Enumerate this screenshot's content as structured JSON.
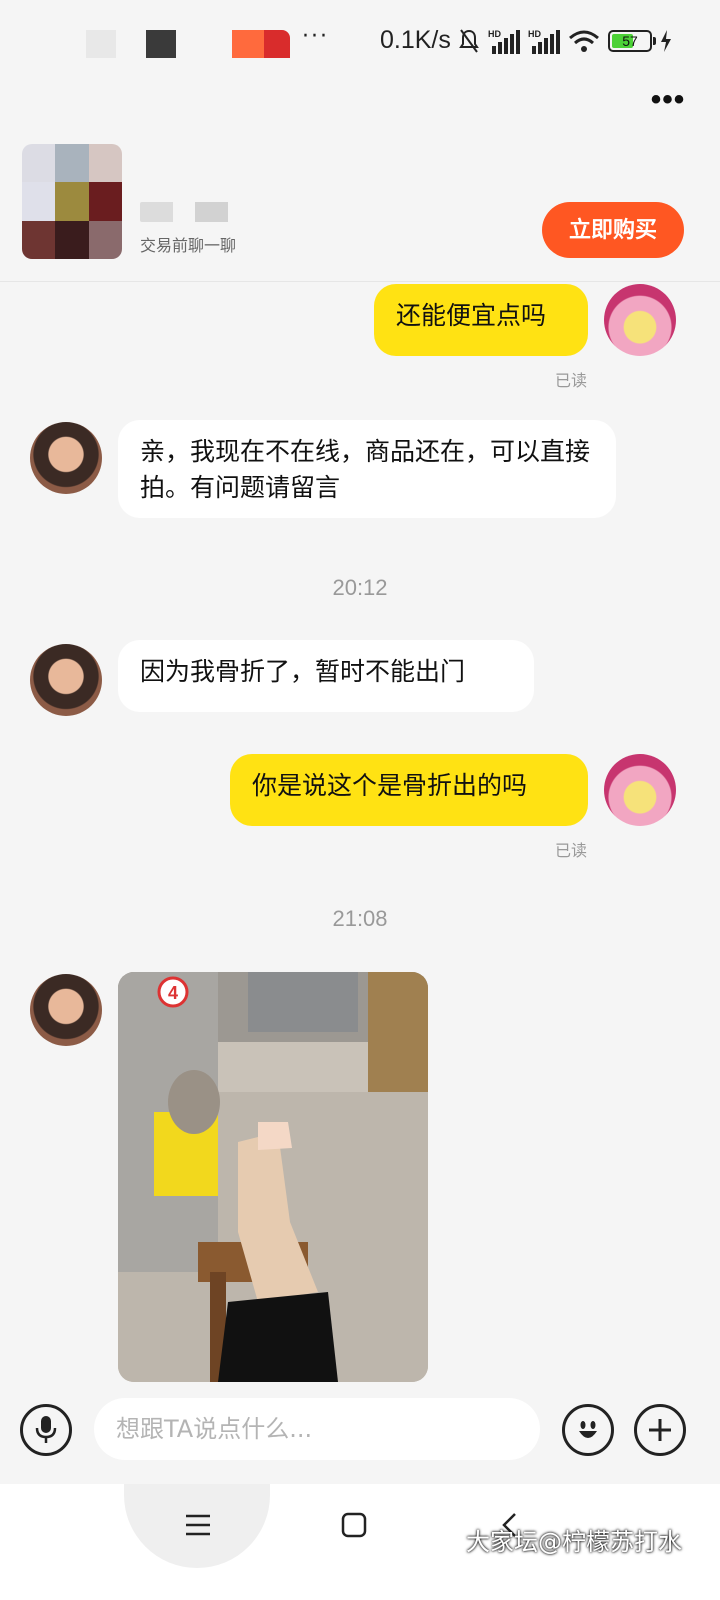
{
  "status_bar": {
    "network_speed": "0.1K/s",
    "battery_level": "57",
    "battery_fraction": 0.57,
    "icons": [
      "mute-bell-icon",
      "hd-signal-icon",
      "hd-signal-icon",
      "wifi-icon",
      "battery-icon",
      "charging-icon"
    ]
  },
  "header": {
    "more_icon": "more-dots-icon"
  },
  "product": {
    "subtitle": "交易前聊一聊",
    "buy_label": "立即购买",
    "buy_color": "#ff5722"
  },
  "messages": [
    {
      "side": "me",
      "text": "还能便宜点吗",
      "read_label": "已读"
    },
    {
      "side": "peer",
      "text": "亲，我现在不在线，商品还在，可以直接拍。有问题请留言"
    },
    {
      "type": "time",
      "text": "20:12"
    },
    {
      "side": "peer",
      "text": "因为我骨折了，暂时不能出门"
    },
    {
      "side": "me",
      "text": "你是说这个是骨折出的吗",
      "read_label": "已读"
    },
    {
      "type": "time",
      "text": "21:08"
    },
    {
      "side": "peer",
      "type": "image",
      "badge": "4"
    }
  ],
  "input_bar": {
    "placeholder": "想跟TA说点什么...",
    "voice_icon": "microphone-icon",
    "emoji_icon": "emoji-icon",
    "plus_icon": "plus-icon"
  },
  "nav": {
    "menu_icon": "menu-icon",
    "home_icon": "home-square-icon",
    "back_icon": "back-chevron-icon"
  },
  "watermark": "大家坛@柠檬苏打水",
  "colors": {
    "my_bubble": "#ffe213",
    "peer_bubble": "#ffffff",
    "background": "#f5f5f5"
  }
}
